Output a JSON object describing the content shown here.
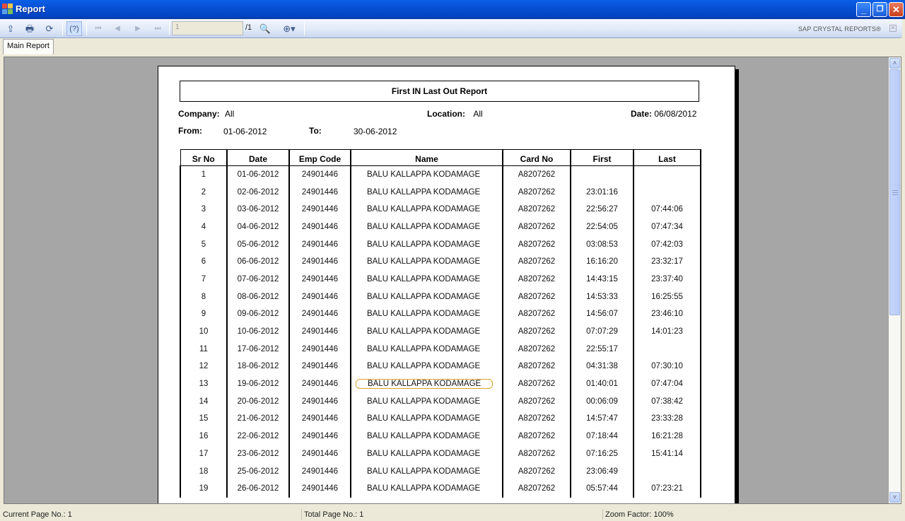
{
  "window": {
    "title": "Report",
    "minimize": "_",
    "restore": "❐",
    "close": "✕"
  },
  "toolbar": {
    "export_icon": "⇪",
    "print_icon": "🖶",
    "refresh_icon": "⟳",
    "help_icon": "(?)",
    "first_icon": "⏮",
    "prev_icon": "◀",
    "next_icon": "▶",
    "last_icon": "⏭",
    "page_input_value": "1",
    "page_total": "/1",
    "find_icon": "🔍",
    "zoom_icon": "⊕▾",
    "brand": "SAP CRYSTAL REPORTS®",
    "brand_close": "✕"
  },
  "tabs": [
    {
      "label": "Main Report"
    }
  ],
  "report": {
    "title": "First IN Last Out Report",
    "company_label": "Company:",
    "company_value": "All",
    "location_label": "Location:",
    "location_value": "All",
    "date_label": "Date:",
    "date_value": "06/08/2012",
    "from_label": "From:",
    "from_value": "01-06-2012",
    "to_label": "To:",
    "to_value": "30-06-2012",
    "columns": [
      "Sr No",
      "Date",
      "Emp Code",
      "Name",
      "Card No",
      "First",
      "Last"
    ],
    "rows": [
      [
        "1",
        "01-06-2012",
        "24901446",
        "BALU KALLAPPA KODAMAGE",
        "A8207262",
        "",
        ""
      ],
      [
        "2",
        "02-06-2012",
        "24901446",
        "BALU KALLAPPA KODAMAGE",
        "A8207262",
        "23:01:16",
        ""
      ],
      [
        "3",
        "03-06-2012",
        "24901446",
        "BALU KALLAPPA KODAMAGE",
        "A8207262",
        "22:56:27",
        "07:44:06"
      ],
      [
        "4",
        "04-06-2012",
        "24901446",
        "BALU KALLAPPA KODAMAGE",
        "A8207262",
        "22:54:05",
        "07:47:34"
      ],
      [
        "5",
        "05-06-2012",
        "24901446",
        "BALU KALLAPPA KODAMAGE",
        "A8207262",
        "03:08:53",
        "07:42:03"
      ],
      [
        "6",
        "06-06-2012",
        "24901446",
        "BALU KALLAPPA KODAMAGE",
        "A8207262",
        "16:16:20",
        "23:32:17"
      ],
      [
        "7",
        "07-06-2012",
        "24901446",
        "BALU KALLAPPA KODAMAGE",
        "A8207262",
        "14:43:15",
        "23:37:40"
      ],
      [
        "8",
        "08-06-2012",
        "24901446",
        "BALU KALLAPPA KODAMAGE",
        "A8207262",
        "14:53:33",
        "16:25:55"
      ],
      [
        "9",
        "09-06-2012",
        "24901446",
        "BALU KALLAPPA KODAMAGE",
        "A8207262",
        "14:56:07",
        "23:46:10"
      ],
      [
        "10",
        "10-06-2012",
        "24901446",
        "BALU KALLAPPA KODAMAGE",
        "A8207262",
        "07:07:29",
        "14:01:23"
      ],
      [
        "11",
        "17-06-2012",
        "24901446",
        "BALU KALLAPPA KODAMAGE",
        "A8207262",
        "22:55:17",
        ""
      ],
      [
        "12",
        "18-06-2012",
        "24901446",
        "BALU KALLAPPA KODAMAGE",
        "A8207262",
        "04:31:38",
        "07:30:10"
      ],
      [
        "13",
        "19-06-2012",
        "24901446",
        "BALU KALLAPPA KODAMAGE",
        "A8207262",
        "01:40:01",
        "07:47:04"
      ],
      [
        "14",
        "20-06-2012",
        "24901446",
        "BALU KALLAPPA KODAMAGE",
        "A8207262",
        "00:06:09",
        "07:38:42"
      ],
      [
        "15",
        "21-06-2012",
        "24901446",
        "BALU KALLAPPA KODAMAGE",
        "A8207262",
        "14:57:47",
        "23:33:28"
      ],
      [
        "16",
        "22-06-2012",
        "24901446",
        "BALU KALLAPPA KODAMAGE",
        "A8207262",
        "07:18:44",
        "16:21:28"
      ],
      [
        "17",
        "23-06-2012",
        "24901446",
        "BALU KALLAPPA KODAMAGE",
        "A8207262",
        "07:16:25",
        "15:41:14"
      ],
      [
        "18",
        "25-06-2012",
        "24901446",
        "BALU KALLAPPA KODAMAGE",
        "A8207262",
        "23:06:49",
        ""
      ],
      [
        "19",
        "26-06-2012",
        "24901446",
        "BALU KALLAPPA KODAMAGE",
        "A8207262",
        "05:57:44",
        "07:23:21"
      ]
    ],
    "selected_row_index": 12
  },
  "scrollbar": {
    "up_icon": "˄",
    "down_icon": "˅"
  },
  "status": {
    "current_page": "Current Page No.: 1",
    "total_page": "Total Page No.: 1",
    "zoom_factor": "Zoom Factor: 100%"
  }
}
